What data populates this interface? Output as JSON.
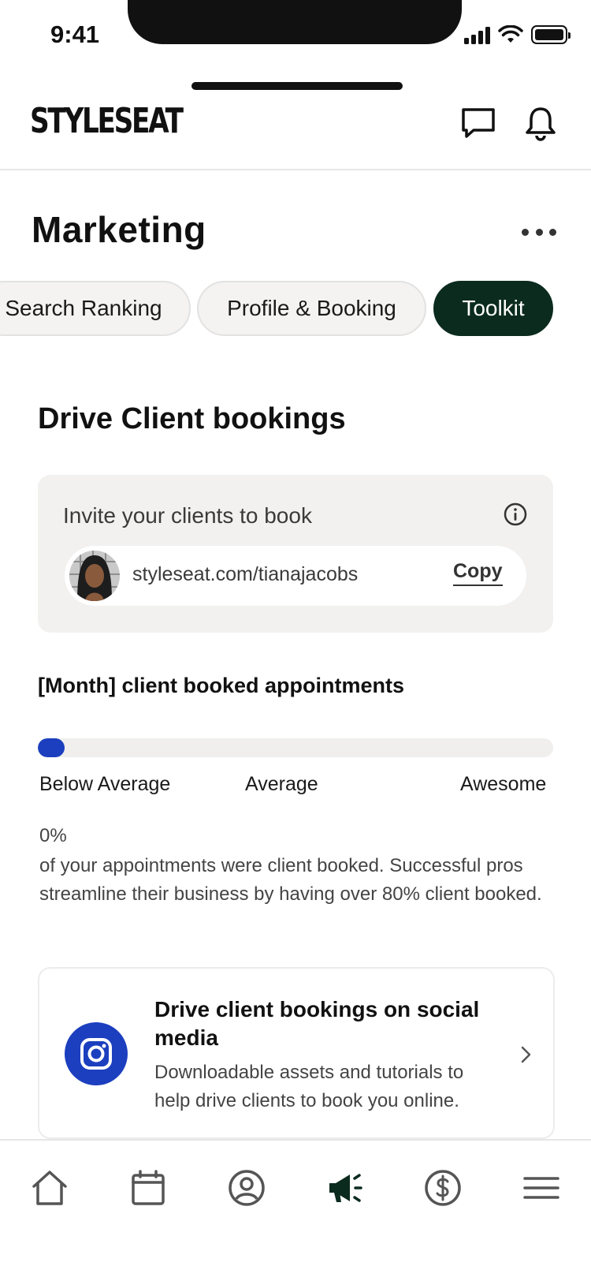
{
  "status_bar": {
    "time": "9:41"
  },
  "header": {
    "logo": "STYLESEAT",
    "icons": [
      "message-icon",
      "bell-icon"
    ]
  },
  "page": {
    "title": "Marketing"
  },
  "tabs": [
    {
      "label": "Search Ranking",
      "active": false
    },
    {
      "label": "Profile & Booking",
      "active": false
    },
    {
      "label": "Toolkit",
      "active": true
    }
  ],
  "section": {
    "title": "Drive Client bookings"
  },
  "invite": {
    "label": "Invite your clients to book",
    "link": "styleseat.com/tianajacobs",
    "copy_label": "Copy"
  },
  "stats": {
    "title": "[Month] client booked appointments",
    "progress_percent": 0,
    "scale_labels": [
      "Below Average",
      "Average",
      "Awesome"
    ],
    "percent_text": "0%",
    "description": "of your appointments were client booked. Successful pros streamline their business by having over 80% client booked."
  },
  "social_card": {
    "title": "Drive client bookings on social media",
    "description": "Downloadable assets and tutorials to help drive clients to book you online."
  },
  "bottom_nav": [
    {
      "icon": "home-icon",
      "active": false
    },
    {
      "icon": "calendar-icon",
      "active": false
    },
    {
      "icon": "profile-icon",
      "active": false
    },
    {
      "icon": "megaphone-icon",
      "active": true
    },
    {
      "icon": "dollar-icon",
      "active": false
    },
    {
      "icon": "menu-icon",
      "active": false
    }
  ],
  "colors": {
    "accent_dark_green": "#0b2b1f",
    "brand_blue": "#1c3fbf",
    "card_bg": "#f2f1ef"
  }
}
